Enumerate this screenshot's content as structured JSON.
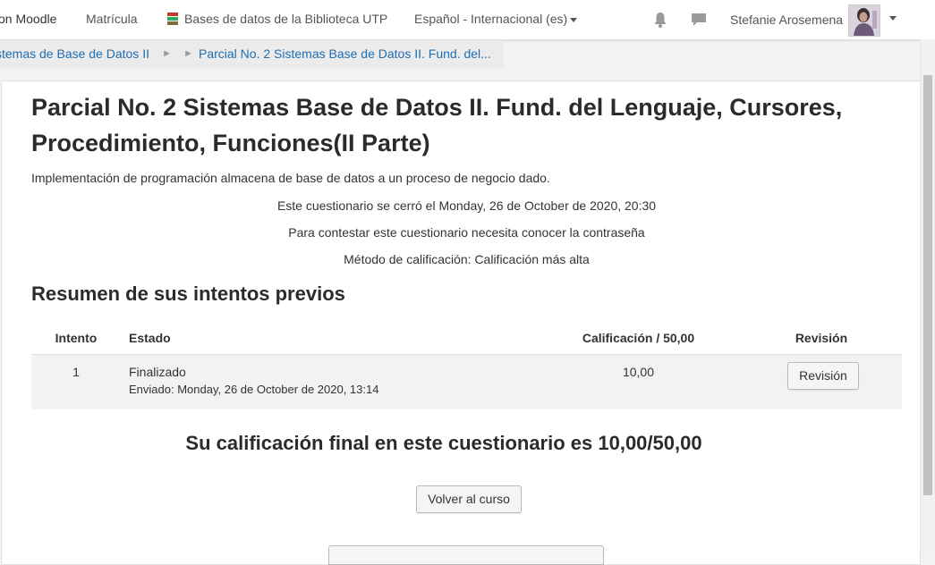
{
  "navbar": {
    "brand": "on Moodle",
    "matricula": "Matrícula",
    "bases": "Bases de datos de la Biblioteca UTP",
    "language": "Español - Internacional (es)",
    "notifications_icon": "bell-icon",
    "messages_icon": "chat-icon",
    "user_name": "Stefanie Arosemena"
  },
  "breadcrumb": {
    "course": "stemas de Base de Datos II",
    "current": "Parcial No. 2 Sistemas Base de Datos II. Fund. del...",
    "separator": "►"
  },
  "quiz": {
    "title": "Parcial No. 2 Sistemas Base de Datos II. Fund. del Lenguaje, Cursores, Procedimiento, Funciones(II Parte)",
    "intro": "Implementación de programación almacena de base de datos a un proceso de negocio dado.",
    "closed": "Este cuestionario se cerró el Monday, 26 de October de 2020, 20:30",
    "password_note": "Para contestar este cuestionario necesita conocer la contraseña",
    "grading_method": "Método de calificación: Calificación más alta"
  },
  "attempts": {
    "heading": "Resumen de sus intentos previos",
    "columns": [
      "Intento",
      "Estado",
      "Calificación / 50,00",
      "Revisión"
    ],
    "rows": [
      {
        "attempt": "1",
        "state": "Finalizado",
        "submitted": "Enviado: Monday, 26 de October de 2020, 13:14",
        "grade": "10,00",
        "review": "Revisión"
      }
    ]
  },
  "final_grade": "Su calificación final en este cuestionario es 10,00/50,00",
  "back_button": "Volver al curso",
  "colors": {
    "link": "#1f6fb2",
    "page_bg": "#f2f2f2",
    "row_bg": "#f2f2f2"
  }
}
